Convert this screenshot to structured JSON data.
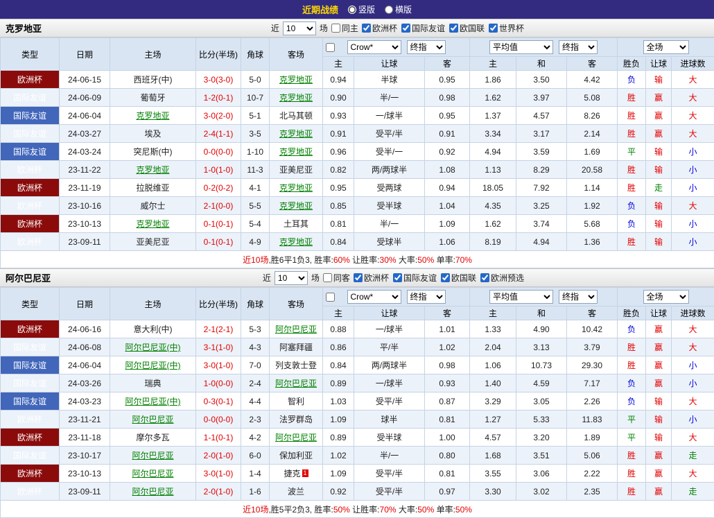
{
  "topbar": {
    "title": "近期战绩",
    "vertical_label": "竖版",
    "horizontal_label": "横版"
  },
  "table_headers": {
    "cols": [
      "类型",
      "日期",
      "主场",
      "比分(半场)",
      "角球",
      "客场"
    ],
    "sub": [
      "主",
      "让球",
      "客",
      "主",
      "和",
      "客",
      "胜负",
      "让球",
      "进球数"
    ]
  },
  "sections": [
    {
      "team": "克罗地亚",
      "near_label": "近",
      "count_value": "10",
      "games_label": "场",
      "same_label": "同主",
      "same_checked": false,
      "filters": [
        {
          "label": "欧洲杯",
          "checked": true
        },
        {
          "label": "国际友谊",
          "checked": true
        },
        {
          "label": "欧国联",
          "checked": true
        },
        {
          "label": "世界杯",
          "checked": true
        }
      ],
      "bookmaker": "Crow*",
      "odds_stage": "终指",
      "average": "平均值",
      "avg_stage": "终指",
      "scope": "全场",
      "rows": [
        {
          "type": "欧洲杯",
          "tc": "euro",
          "date": "24-06-15",
          "home": "西班牙(中)",
          "ht": false,
          "score": "3-0(3-0)",
          "corner": "5-0",
          "away": "克罗地亚",
          "at": true,
          "badge": "",
          "odds": [
            "0.94",
            "半球",
            "0.95"
          ],
          "avg": [
            "1.86",
            "3.50",
            "4.42"
          ],
          "res": [
            [
              "负",
              "b"
            ],
            [
              "输",
              "r"
            ],
            [
              "大",
              "r"
            ]
          ]
        },
        {
          "type": "国际友谊",
          "tc": "friendly",
          "date": "24-06-09",
          "home": "葡萄牙",
          "ht": false,
          "score": "1-2(0-1)",
          "corner": "10-7",
          "away": "克罗地亚",
          "at": true,
          "badge": "",
          "odds": [
            "0.90",
            "半/一",
            "0.98"
          ],
          "avg": [
            "1.62",
            "3.97",
            "5.08"
          ],
          "res": [
            [
              "胜",
              "r"
            ],
            [
              "赢",
              "r"
            ],
            [
              "大",
              "r"
            ]
          ]
        },
        {
          "type": "国际友谊",
          "tc": "friendly",
          "date": "24-06-04",
          "home": "克罗地亚",
          "ht": true,
          "score": "3-0(2-0)",
          "corner": "5-1",
          "away": "北马其顿",
          "at": false,
          "badge": "",
          "odds": [
            "0.93",
            "一/球半",
            "0.95"
          ],
          "avg": [
            "1.37",
            "4.57",
            "8.26"
          ],
          "res": [
            [
              "胜",
              "r"
            ],
            [
              "赢",
              "r"
            ],
            [
              "大",
              "r"
            ]
          ]
        },
        {
          "type": "国际友谊",
          "tc": "friendly",
          "date": "24-03-27",
          "home": "埃及",
          "ht": false,
          "score": "2-4(1-1)",
          "corner": "3-5",
          "away": "克罗地亚",
          "at": true,
          "badge": "",
          "odds": [
            "0.91",
            "受平/半",
            "0.91"
          ],
          "avg": [
            "3.34",
            "3.17",
            "2.14"
          ],
          "res": [
            [
              "胜",
              "r"
            ],
            [
              "赢",
              "r"
            ],
            [
              "大",
              "r"
            ]
          ]
        },
        {
          "type": "国际友谊",
          "tc": "friendly",
          "date": "24-03-24",
          "home": "突尼斯(中)",
          "ht": false,
          "score": "0-0(0-0)",
          "corner": "1-10",
          "away": "克罗地亚",
          "at": true,
          "badge": "",
          "odds": [
            "0.96",
            "受半/一",
            "0.92"
          ],
          "avg": [
            "4.94",
            "3.59",
            "1.69"
          ],
          "res": [
            [
              "平",
              "g"
            ],
            [
              "输",
              "r"
            ],
            [
              "小",
              "b"
            ]
          ]
        },
        {
          "type": "欧洲杯",
          "tc": "euro",
          "date": "23-11-22",
          "home": "克罗地亚",
          "ht": true,
          "score": "1-0(1-0)",
          "corner": "11-3",
          "away": "亚美尼亚",
          "at": false,
          "badge": "",
          "odds": [
            "0.82",
            "两/两球半",
            "1.08"
          ],
          "avg": [
            "1.13",
            "8.29",
            "20.58"
          ],
          "res": [
            [
              "胜",
              "r"
            ],
            [
              "输",
              "r"
            ],
            [
              "小",
              "b"
            ]
          ]
        },
        {
          "type": "欧洲杯",
          "tc": "euro",
          "date": "23-11-19",
          "home": "拉脱维亚",
          "ht": false,
          "score": "0-2(0-2)",
          "corner": "4-1",
          "away": "克罗地亚",
          "at": true,
          "badge": "",
          "odds": [
            "0.95",
            "受两球",
            "0.94"
          ],
          "avg": [
            "18.05",
            "7.92",
            "1.14"
          ],
          "res": [
            [
              "胜",
              "r"
            ],
            [
              "走",
              "g"
            ],
            [
              "小",
              "b"
            ]
          ]
        },
        {
          "type": "欧洲杯",
          "tc": "euro",
          "date": "23-10-16",
          "home": "威尔士",
          "ht": false,
          "score": "2-1(0-0)",
          "corner": "5-5",
          "away": "克罗地亚",
          "at": true,
          "badge": "",
          "odds": [
            "0.85",
            "受半球",
            "1.04"
          ],
          "avg": [
            "4.35",
            "3.25",
            "1.92"
          ],
          "res": [
            [
              "负",
              "b"
            ],
            [
              "输",
              "r"
            ],
            [
              "大",
              "r"
            ]
          ]
        },
        {
          "type": "欧洲杯",
          "tc": "euro",
          "date": "23-10-13",
          "home": "克罗地亚",
          "ht": true,
          "score": "0-1(0-1)",
          "corner": "5-4",
          "away": "土耳其",
          "at": false,
          "badge": "",
          "odds": [
            "0.81",
            "半/一",
            "1.09"
          ],
          "avg": [
            "1.62",
            "3.74",
            "5.68"
          ],
          "res": [
            [
              "负",
              "b"
            ],
            [
              "输",
              "r"
            ],
            [
              "小",
              "b"
            ]
          ]
        },
        {
          "type": "欧洲杯",
          "tc": "euro",
          "date": "23-09-11",
          "home": "亚美尼亚",
          "ht": false,
          "score": "0-1(0-1)",
          "corner": "4-9",
          "away": "克罗地亚",
          "at": true,
          "badge": "",
          "odds": [
            "0.84",
            "受球半",
            "1.06"
          ],
          "avg": [
            "8.19",
            "4.94",
            "1.36"
          ],
          "res": [
            [
              "胜",
              "r"
            ],
            [
              "输",
              "r"
            ],
            [
              "小",
              "b"
            ]
          ]
        }
      ],
      "summary": [
        {
          "t": "近10场",
          "c": "r"
        },
        {
          "t": ",胜6平1负3, 胜率:",
          "c": ""
        },
        {
          "t": "60%",
          "c": "r"
        },
        {
          "t": " 让胜率:",
          "c": ""
        },
        {
          "t": "30%",
          "c": "r"
        },
        {
          "t": " 大率:",
          "c": ""
        },
        {
          "t": "50%",
          "c": "r"
        },
        {
          "t": " 单率:",
          "c": ""
        },
        {
          "t": "70%",
          "c": "r"
        }
      ]
    },
    {
      "team": "阿尔巴尼亚",
      "near_label": "近",
      "count_value": "10",
      "games_label": "场",
      "same_label": "同客",
      "same_checked": false,
      "filters": [
        {
          "label": "欧洲杯",
          "checked": true
        },
        {
          "label": "国际友谊",
          "checked": true
        },
        {
          "label": "欧国联",
          "checked": true
        },
        {
          "label": "欧洲预选",
          "checked": true
        }
      ],
      "bookmaker": "Crow*",
      "odds_stage": "终指",
      "average": "平均值",
      "avg_stage": "终指",
      "scope": "全场",
      "rows": [
        {
          "type": "欧洲杯",
          "tc": "euro",
          "date": "24-06-16",
          "home": "意大利(中)",
          "ht": false,
          "score": "2-1(2-1)",
          "corner": "5-3",
          "away": "阿尔巴尼亚",
          "at": true,
          "badge": "",
          "odds": [
            "0.88",
            "一/球半",
            "1.01"
          ],
          "avg": [
            "1.33",
            "4.90",
            "10.42"
          ],
          "res": [
            [
              "负",
              "b"
            ],
            [
              "赢",
              "r"
            ],
            [
              "大",
              "r"
            ]
          ]
        },
        {
          "type": "国际友谊",
          "tc": "friendly",
          "date": "24-06-08",
          "home": "阿尔巴尼亚(中)",
          "ht": true,
          "score": "3-1(1-0)",
          "corner": "4-3",
          "away": "阿塞拜疆",
          "at": false,
          "badge": "",
          "odds": [
            "0.86",
            "平/半",
            "1.02"
          ],
          "avg": [
            "2.04",
            "3.13",
            "3.79"
          ],
          "res": [
            [
              "胜",
              "r"
            ],
            [
              "赢",
              "r"
            ],
            [
              "大",
              "r"
            ]
          ]
        },
        {
          "type": "国际友谊",
          "tc": "friendly",
          "date": "24-06-04",
          "home": "阿尔巴尼亚(中)",
          "ht": true,
          "score": "3-0(1-0)",
          "corner": "7-0",
          "away": "列支敦士登",
          "at": false,
          "badge": "",
          "odds": [
            "0.84",
            "两/两球半",
            "0.98"
          ],
          "avg": [
            "1.06",
            "10.73",
            "29.30"
          ],
          "res": [
            [
              "胜",
              "r"
            ],
            [
              "赢",
              "r"
            ],
            [
              "小",
              "b"
            ]
          ]
        },
        {
          "type": "国际友谊",
          "tc": "friendly",
          "date": "24-03-26",
          "home": "瑞典",
          "ht": false,
          "score": "1-0(0-0)",
          "corner": "2-4",
          "away": "阿尔巴尼亚",
          "at": true,
          "badge": "",
          "odds": [
            "0.89",
            "一/球半",
            "0.93"
          ],
          "avg": [
            "1.40",
            "4.59",
            "7.17"
          ],
          "res": [
            [
              "负",
              "b"
            ],
            [
              "赢",
              "r"
            ],
            [
              "小",
              "b"
            ]
          ]
        },
        {
          "type": "国际友谊",
          "tc": "friendly",
          "date": "24-03-23",
          "home": "阿尔巴尼亚(中)",
          "ht": true,
          "score": "0-3(0-1)",
          "corner": "4-4",
          "away": "智利",
          "at": false,
          "badge": "",
          "odds": [
            "1.03",
            "受平/半",
            "0.87"
          ],
          "avg": [
            "3.29",
            "3.05",
            "2.26"
          ],
          "res": [
            [
              "负",
              "b"
            ],
            [
              "输",
              "r"
            ],
            [
              "大",
              "r"
            ]
          ]
        },
        {
          "type": "欧洲杯",
          "tc": "euro",
          "date": "23-11-21",
          "home": "阿尔巴尼亚",
          "ht": true,
          "score": "0-0(0-0)",
          "corner": "2-3",
          "away": "法罗群岛",
          "at": false,
          "badge": "",
          "odds": [
            "1.09",
            "球半",
            "0.81"
          ],
          "avg": [
            "1.27",
            "5.33",
            "11.83"
          ],
          "res": [
            [
              "平",
              "g"
            ],
            [
              "输",
              "r"
            ],
            [
              "小",
              "b"
            ]
          ]
        },
        {
          "type": "欧洲杯",
          "tc": "euro",
          "date": "23-11-18",
          "home": "摩尔多瓦",
          "ht": false,
          "score": "1-1(0-1)",
          "corner": "4-2",
          "away": "阿尔巴尼亚",
          "at": true,
          "badge": "",
          "odds": [
            "0.89",
            "受半球",
            "1.00"
          ],
          "avg": [
            "4.57",
            "3.20",
            "1.89"
          ],
          "res": [
            [
              "平",
              "g"
            ],
            [
              "输",
              "r"
            ],
            [
              "大",
              "r"
            ]
          ]
        },
        {
          "type": "国际友谊",
          "tc": "friendly",
          "date": "23-10-17",
          "home": "阿尔巴尼亚",
          "ht": true,
          "score": "2-0(1-0)",
          "corner": "6-0",
          "away": "保加利亚",
          "at": false,
          "badge": "",
          "odds": [
            "1.02",
            "半/一",
            "0.80"
          ],
          "avg": [
            "1.68",
            "3.51",
            "5.06"
          ],
          "res": [
            [
              "胜",
              "r"
            ],
            [
              "赢",
              "r"
            ],
            [
              "走",
              "g"
            ]
          ]
        },
        {
          "type": "欧洲杯",
          "tc": "euro",
          "date": "23-10-13",
          "home": "阿尔巴尼亚",
          "ht": true,
          "score": "3-0(1-0)",
          "corner": "1-4",
          "away": "捷克",
          "at": false,
          "badge": "1",
          "odds": [
            "1.09",
            "受平/半",
            "0.81"
          ],
          "avg": [
            "3.55",
            "3.06",
            "2.22"
          ],
          "res": [
            [
              "胜",
              "r"
            ],
            [
              "赢",
              "r"
            ],
            [
              "大",
              "r"
            ]
          ]
        },
        {
          "type": "欧洲杯",
          "tc": "euro",
          "date": "23-09-11",
          "home": "阿尔巴尼亚",
          "ht": true,
          "score": "2-0(1-0)",
          "corner": "1-6",
          "away": "波兰",
          "at": false,
          "badge": "",
          "odds": [
            "0.92",
            "受平/半",
            "0.97"
          ],
          "avg": [
            "3.30",
            "3.02",
            "2.35"
          ],
          "res": [
            [
              "胜",
              "r"
            ],
            [
              "赢",
              "r"
            ],
            [
              "走",
              "g"
            ]
          ]
        }
      ],
      "summary": [
        {
          "t": "近10场",
          "c": "r"
        },
        {
          "t": ",胜5平2负3, 胜率:",
          "c": ""
        },
        {
          "t": "50%",
          "c": "r"
        },
        {
          "t": " 让胜率:",
          "c": ""
        },
        {
          "t": "70%",
          "c": "r"
        },
        {
          "t": " 大率:",
          "c": ""
        },
        {
          "t": "50%",
          "c": "r"
        },
        {
          "t": " 单率:",
          "c": ""
        },
        {
          "t": "50%",
          "c": "r"
        }
      ]
    }
  ]
}
